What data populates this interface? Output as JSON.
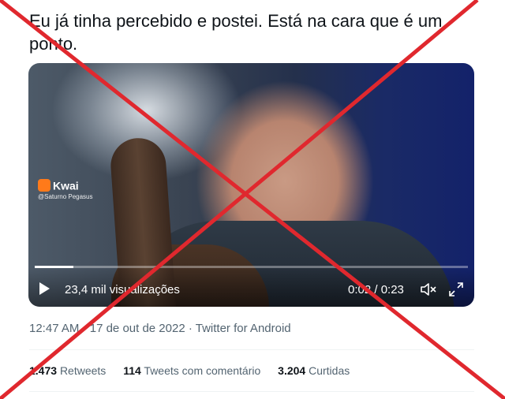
{
  "tweet": {
    "text": "Eu já tinha percebido e postei. Está na cara que é um ponto."
  },
  "video": {
    "watermark_brand": "Kwai",
    "watermark_user": "@Saturno Pegasus",
    "views": "23,4 mil visualizações",
    "time": "0:02 / 0:23",
    "progress": 0.09,
    "play_icon": "play-icon",
    "mute_icon": "muted-speaker-icon",
    "fullscreen_icon": "fullscreen-icon"
  },
  "meta": {
    "time": "12:47 AM",
    "separator1": " · ",
    "date": "17 de out de 2022",
    "separator2": " · ",
    "source": "Twitter for Android"
  },
  "stats": {
    "retweets_count": "1.473",
    "retweets_label": "Retweets",
    "quotes_count": "114",
    "quotes_label": "Tweets com comentário",
    "likes_count": "3.204",
    "likes_label": "Curtidas"
  },
  "overlay": {
    "cross_color": "#e0282e"
  }
}
